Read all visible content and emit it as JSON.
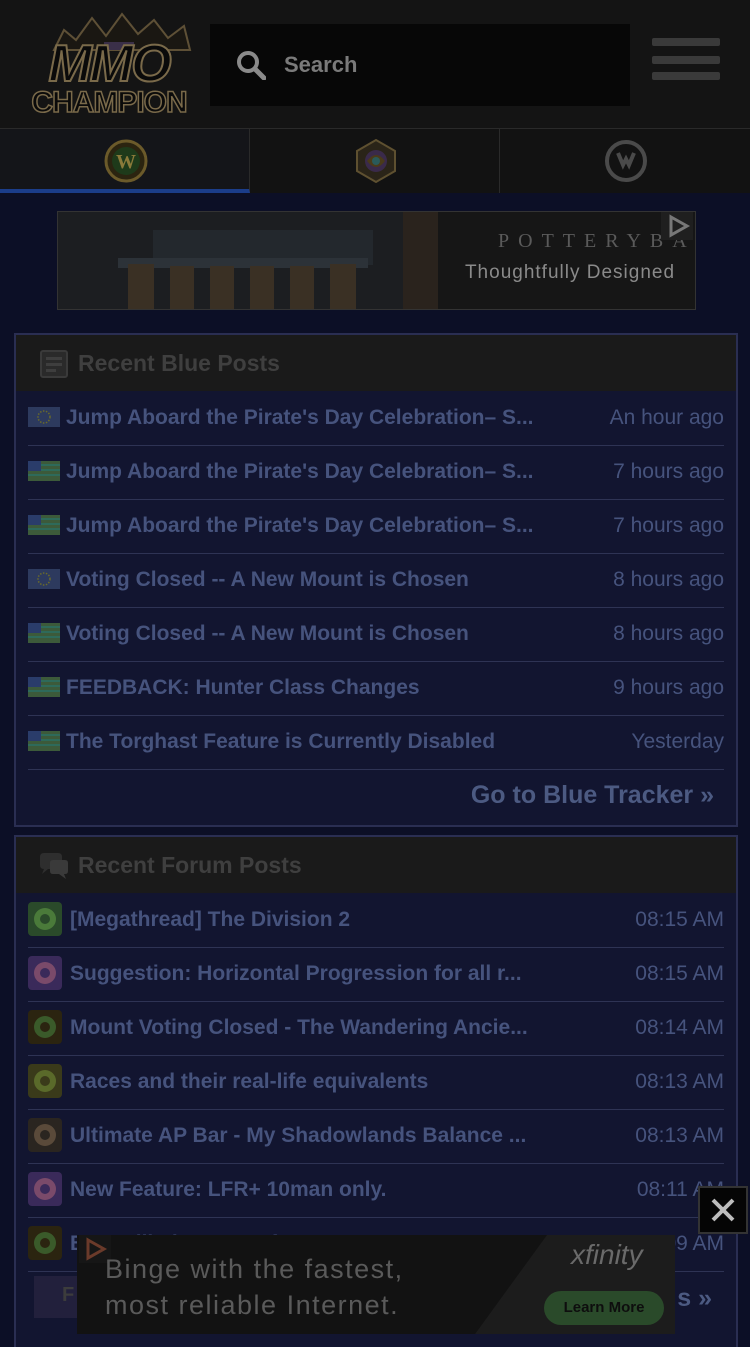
{
  "header": {
    "logo_top": "MMO",
    "logo_bottom": "CHAMPION",
    "search_placeholder": "Search"
  },
  "tabs": [
    {
      "name": "World of Warcraft",
      "icon": "wow-icon",
      "active": true
    },
    {
      "name": "Hearthstone",
      "icon": "hearthstone-icon",
      "active": false
    },
    {
      "name": "Overwatch",
      "icon": "overwatch-icon",
      "active": false
    }
  ],
  "top_ad": {
    "brand": "POTTERYBARN",
    "tagline": "Thoughtfully Designed"
  },
  "blue_posts": {
    "title": "Recent Blue Posts",
    "items": [
      {
        "title": "Jump Aboard the Pirate's Day Celebration– S...",
        "time": "An hour ago",
        "region": "eu"
      },
      {
        "title": "Jump Aboard the Pirate's Day Celebration– S...",
        "time": "7 hours ago",
        "region": "us"
      },
      {
        "title": "Jump Aboard the Pirate's Day Celebration– S...",
        "time": "7 hours ago",
        "region": "us"
      },
      {
        "title": "Voting Closed -- A New Mount is Chosen",
        "time": "8 hours ago",
        "region": "eu"
      },
      {
        "title": "Voting Closed -- A New Mount is Chosen",
        "time": "8 hours ago",
        "region": "us"
      },
      {
        "title": "FEEDBACK: Hunter Class Changes",
        "time": "9 hours ago",
        "region": "us"
      },
      {
        "title": "The Torghast Feature is Currently Disabled",
        "time": "Yesterday",
        "region": "us"
      }
    ],
    "more_link": "Go to Blue Tracker »"
  },
  "forum_posts": {
    "title": "Recent Forum Posts",
    "items": [
      {
        "title": "[Megathread] The Division 2",
        "time": "08:15 AM",
        "icon": "division-forum-icon"
      },
      {
        "title": "Suggestion: Horizontal Progression for all r...",
        "time": "08:15 AM",
        "icon": "general-forum-icon"
      },
      {
        "title": "Mount Voting Closed - The Wandering Ancie...",
        "time": "08:14 AM",
        "icon": "wow-forum-icon"
      },
      {
        "title": "Races and their real-life equivalents",
        "time": "08:13 AM",
        "icon": "lore-forum-icon"
      },
      {
        "title": "Ultimate AP Bar - My Shadowlands Balance ...",
        "time": "08:13 AM",
        "icon": "druid-forum-icon"
      },
      {
        "title": "New Feature: LFR+ 10man only.",
        "time": "08:11 AM",
        "icon": "general-forum-icon"
      },
      {
        "title": "Best Allied Race so far?",
        "time": "08:09 AM",
        "icon": "wow-forum-icon"
      }
    ],
    "more_link_partial": "s »"
  },
  "bottom_ad": {
    "copy": "Binge with the fastest,\nmost reliable Internet.",
    "brand": "xfinity",
    "cta": "Learn More"
  },
  "colors": {
    "page_bg": "#0c0f26",
    "panel_bg": "#121530",
    "link": "#46537d",
    "active_tab_underline": "#1b3d8a"
  }
}
